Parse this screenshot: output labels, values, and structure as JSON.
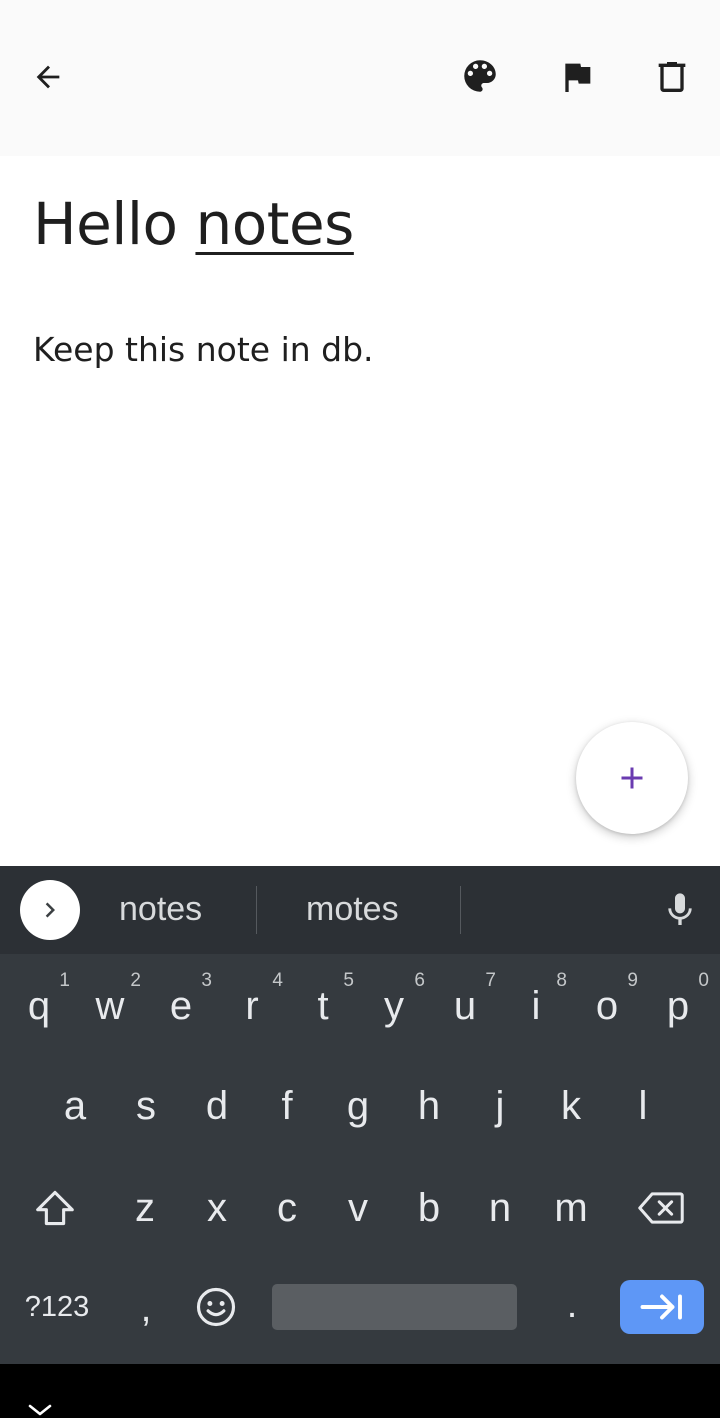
{
  "app_bar": {
    "back_icon": "arrow-back-icon",
    "actions": [
      {
        "icon": "palette-icon"
      },
      {
        "icon": "flag-icon"
      },
      {
        "icon": "trash-icon"
      }
    ]
  },
  "note": {
    "title_word_1": "Hello",
    "title_word_2": "notes",
    "body": "Keep this note in db."
  },
  "fab": {
    "icon": "plus-icon",
    "color": "#6a3bb0"
  },
  "keyboard": {
    "suggestions": [
      "notes",
      "motes"
    ],
    "row1": [
      {
        "key": "q",
        "hint": "1"
      },
      {
        "key": "w",
        "hint": "2"
      },
      {
        "key": "e",
        "hint": "3"
      },
      {
        "key": "r",
        "hint": "4"
      },
      {
        "key": "t",
        "hint": "5"
      },
      {
        "key": "y",
        "hint": "6"
      },
      {
        "key": "u",
        "hint": "7"
      },
      {
        "key": "i",
        "hint": "8"
      },
      {
        "key": "o",
        "hint": "9"
      },
      {
        "key": "p",
        "hint": "0"
      }
    ],
    "row2": [
      "a",
      "s",
      "d",
      "f",
      "g",
      "h",
      "j",
      "k",
      "l"
    ],
    "row3": [
      "z",
      "x",
      "c",
      "v",
      "b",
      "n",
      "m"
    ],
    "symbols_label": "?123",
    "comma": ",",
    "period": ".",
    "enter_color": "#5e97f6"
  },
  "colors": {
    "app_bar_bg": "#fafafa",
    "keyboard_bg": "#353a3f",
    "suggest_bg": "#2c3035"
  }
}
